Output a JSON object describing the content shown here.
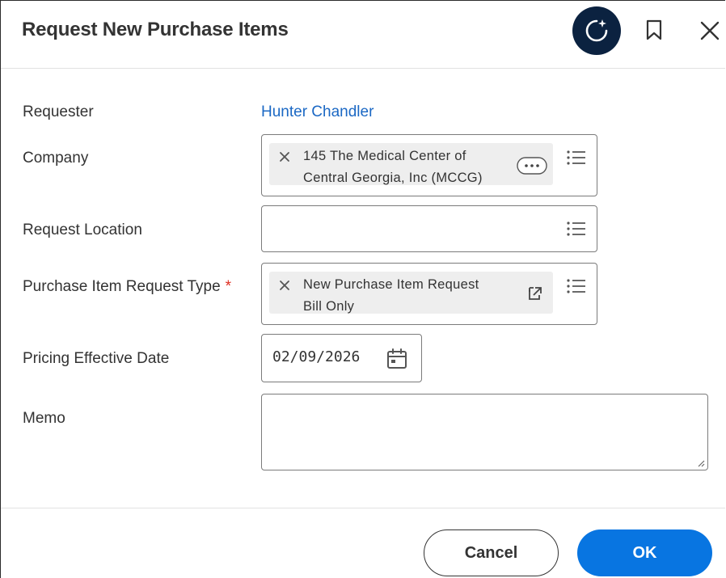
{
  "dialog": {
    "title": "Request New Purchase Items"
  },
  "form": {
    "requester": {
      "label": "Requester",
      "value": "Hunter Chandler"
    },
    "company": {
      "label": "Company",
      "selected_line1": "145 The Medical Center of",
      "selected_line2": "Central Georgia, Inc (MCCG)"
    },
    "request_location": {
      "label": "Request Location",
      "value": ""
    },
    "purchase_item_request_type": {
      "label": "Purchase Item Request Type",
      "required_marker": "*",
      "selected_line1": "New Purchase Item Request",
      "selected_line2": "Bill Only"
    },
    "pricing_effective_date": {
      "label": "Pricing Effective Date",
      "value": "02/09/2026"
    },
    "memo": {
      "label": "Memo",
      "value": ""
    }
  },
  "footer": {
    "cancel_label": "Cancel",
    "ok_label": "OK"
  },
  "icons": {
    "assistant": "sparkle-refresh-icon",
    "bookmark": "bookmark-icon",
    "close": "close-icon",
    "remove": "x-icon",
    "list": "list-icon",
    "more": "more-horizontal-icon",
    "external": "external-link-icon",
    "calendar": "calendar-icon"
  },
  "colors": {
    "primary": "#0875e1",
    "link": "#1b68c4",
    "required": "#de2e21",
    "assistant_bg": "#0b2240",
    "text": "#333333",
    "pill_bg": "#eeeeee"
  }
}
